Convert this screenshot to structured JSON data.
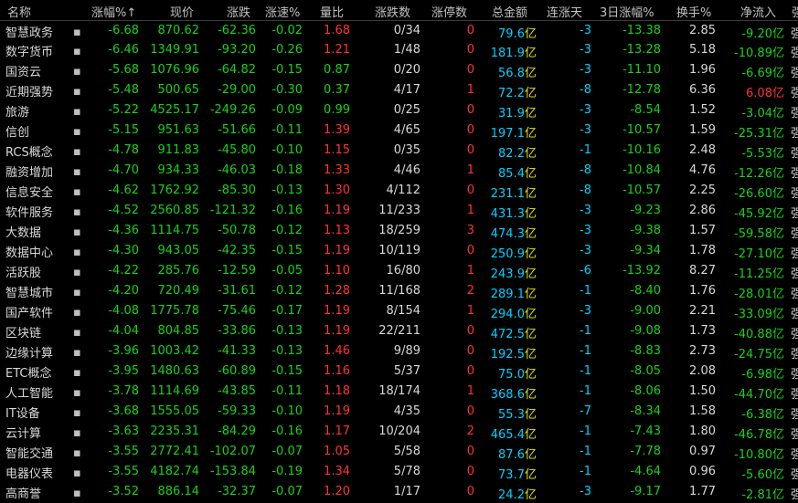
{
  "headers": [
    "名称",
    "涨幅%",
    "现价",
    "涨跌",
    "涨速%",
    "量比",
    "涨跌数",
    "涨停数",
    "总金额",
    "连涨天",
    "3日涨幅%",
    "换手%",
    "净流入",
    "强"
  ],
  "sort_arrow": "↑",
  "unit": "亿",
  "rows": [
    {
      "name": "智慧政务",
      "pct": "-6.68",
      "price": "870.62",
      "chg": "-62.36",
      "spd": "-0.02",
      "vr": "1.68",
      "ud": "0/34",
      "lim": "0",
      "amt": "79.6",
      "days": "-3",
      "d3": "-13.38",
      "turn": "2.85",
      "flow": "-9.20",
      "trail": "强"
    },
    {
      "name": "数字货币",
      "pct": "-6.46",
      "price": "1349.91",
      "chg": "-93.20",
      "spd": "-0.26",
      "vr": "1.21",
      "ud": "1/48",
      "lim": "0",
      "amt": "181.9",
      "days": "-3",
      "d3": "-13.28",
      "turn": "5.18",
      "flow": "-10.89",
      "trail": "强"
    },
    {
      "name": "国资云",
      "pct": "-5.68",
      "price": "1076.96",
      "chg": "-64.82",
      "spd": "-0.15",
      "vr": "0.87",
      "ud": "0/20",
      "lim": "0",
      "amt": "56.8",
      "days": "-3",
      "d3": "-11.10",
      "turn": "1.96",
      "flow": "-6.69",
      "trail": "强"
    },
    {
      "name": "近期强势",
      "pct": "-5.48",
      "price": "500.65",
      "chg": "-29.00",
      "spd": "-0.30",
      "vr": "0.37",
      "ud": "4/17",
      "lim": "1",
      "amt": "72.2",
      "days": "-8",
      "d3": "-12.78",
      "turn": "6.36",
      "flow": "6.08",
      "trail": "强"
    },
    {
      "name": "旅游",
      "pct": "-5.22",
      "price": "4525.17",
      "chg": "-249.26",
      "spd": "-0.09",
      "vr": "0.99",
      "ud": "0/25",
      "lim": "0",
      "amt": "31.9",
      "days": "-3",
      "d3": "-8.54",
      "turn": "1.52",
      "flow": "-3.04",
      "trail": "强"
    },
    {
      "name": "信创",
      "pct": "-5.15",
      "price": "951.63",
      "chg": "-51.66",
      "spd": "-0.11",
      "vr": "1.39",
      "ud": "4/65",
      "lim": "0",
      "amt": "197.1",
      "days": "-3",
      "d3": "-10.57",
      "turn": "1.59",
      "flow": "-25.31",
      "trail": "强"
    },
    {
      "name": "RCS概念",
      "pct": "-4.78",
      "price": "911.83",
      "chg": "-45.80",
      "spd": "-0.10",
      "vr": "1.15",
      "ud": "0/35",
      "lim": "0",
      "amt": "82.2",
      "days": "-1",
      "d3": "-10.16",
      "turn": "2.48",
      "flow": "-5.53",
      "trail": "强"
    },
    {
      "name": "融资增加",
      "pct": "-4.70",
      "price": "934.33",
      "chg": "-46.03",
      "spd": "-0.18",
      "vr": "1.33",
      "ud": "4/46",
      "lim": "1",
      "amt": "85.4",
      "days": "-8",
      "d3": "-10.84",
      "turn": "4.76",
      "flow": "-12.26",
      "trail": "强"
    },
    {
      "name": "信息安全",
      "pct": "-4.62",
      "price": "1762.92",
      "chg": "-85.30",
      "spd": "-0.13",
      "vr": "1.30",
      "ud": "4/112",
      "lim": "0",
      "amt": "231.1",
      "days": "-8",
      "d3": "-10.57",
      "turn": "2.25",
      "flow": "-26.60",
      "trail": "强"
    },
    {
      "name": "软件服务",
      "pct": "-4.52",
      "price": "2560.85",
      "chg": "-121.32",
      "spd": "-0.16",
      "vr": "1.19",
      "ud": "11/233",
      "lim": "1",
      "amt": "431.3",
      "days": "-3",
      "d3": "-9.23",
      "turn": "2.86",
      "flow": "-45.92",
      "trail": "强"
    },
    {
      "name": "大数据",
      "pct": "-4.36",
      "price": "1114.75",
      "chg": "-50.78",
      "spd": "-0.12",
      "vr": "1.13",
      "ud": "18/259",
      "lim": "3",
      "amt": "474.3",
      "days": "-3",
      "d3": "-9.38",
      "turn": "1.57",
      "flow": "-59.58",
      "trail": "强"
    },
    {
      "name": "数据中心",
      "pct": "-4.30",
      "price": "943.05",
      "chg": "-42.35",
      "spd": "-0.15",
      "vr": "1.19",
      "ud": "10/119",
      "lim": "0",
      "amt": "250.9",
      "days": "-3",
      "d3": "-9.34",
      "turn": "1.78",
      "flow": "-27.10",
      "trail": "强"
    },
    {
      "name": "活跃股",
      "pct": "-4.22",
      "price": "285.76",
      "chg": "-12.59",
      "spd": "-0.05",
      "vr": "1.10",
      "ud": "16/80",
      "lim": "1",
      "amt": "243.9",
      "days": "-6",
      "d3": "-13.92",
      "turn": "8.27",
      "flow": "-11.25",
      "trail": "强"
    },
    {
      "name": "智慧城市",
      "pct": "-4.20",
      "price": "720.49",
      "chg": "-31.61",
      "spd": "-0.12",
      "vr": "1.28",
      "ud": "11/168",
      "lim": "2",
      "amt": "289.1",
      "days": "-1",
      "d3": "-8.40",
      "turn": "1.76",
      "flow": "-28.01",
      "trail": "强"
    },
    {
      "name": "国产软件",
      "pct": "-4.08",
      "price": "1775.78",
      "chg": "-75.46",
      "spd": "-0.17",
      "vr": "1.19",
      "ud": "8/154",
      "lim": "1",
      "amt": "294.0",
      "days": "-3",
      "d3": "-9.00",
      "turn": "2.21",
      "flow": "-33.09",
      "trail": "强"
    },
    {
      "name": "区块链",
      "pct": "-4.04",
      "price": "804.85",
      "chg": "-33.86",
      "spd": "-0.13",
      "vr": "1.19",
      "ud": "22/211",
      "lim": "0",
      "amt": "472.5",
      "days": "-1",
      "d3": "-9.08",
      "turn": "1.73",
      "flow": "-40.88",
      "trail": "强"
    },
    {
      "name": "边缘计算",
      "pct": "-3.96",
      "price": "1003.42",
      "chg": "-41.33",
      "spd": "-0.13",
      "vr": "1.46",
      "ud": "9/89",
      "lim": "0",
      "amt": "192.5",
      "days": "-1",
      "d3": "-8.83",
      "turn": "2.73",
      "flow": "-24.75",
      "trail": "强"
    },
    {
      "name": "ETC概念",
      "pct": "-3.95",
      "price": "1480.63",
      "chg": "-60.89",
      "spd": "-0.15",
      "vr": "1.16",
      "ud": "5/37",
      "lim": "0",
      "amt": "75.0",
      "days": "-1",
      "d3": "-8.05",
      "turn": "2.08",
      "flow": "-6.98",
      "trail": "强"
    },
    {
      "name": "人工智能",
      "pct": "-3.78",
      "price": "1114.69",
      "chg": "-43.85",
      "spd": "-0.11",
      "vr": "1.18",
      "ud": "18/174",
      "lim": "1",
      "amt": "368.6",
      "days": "-1",
      "d3": "-8.06",
      "turn": "1.50",
      "flow": "-44.70",
      "trail": "强"
    },
    {
      "name": "IT设备",
      "pct": "-3.68",
      "price": "1555.05",
      "chg": "-59.33",
      "spd": "-0.10",
      "vr": "1.19",
      "ud": "4/35",
      "lim": "0",
      "amt": "55.3",
      "days": "-7",
      "d3": "-8.34",
      "turn": "1.58",
      "flow": "-6.38",
      "trail": "强"
    },
    {
      "name": "云计算",
      "pct": "-3.63",
      "price": "2235.31",
      "chg": "-84.29",
      "spd": "-0.16",
      "vr": "1.17",
      "ud": "10/204",
      "lim": "2",
      "amt": "465.4",
      "days": "-1",
      "d3": "-7.43",
      "turn": "1.80",
      "flow": "-46.78",
      "trail": "强"
    },
    {
      "name": "智能交通",
      "pct": "-3.55",
      "price": "2772.41",
      "chg": "-102.07",
      "spd": "-0.07",
      "vr": "1.05",
      "ud": "5/58",
      "lim": "0",
      "amt": "87.6",
      "days": "-1",
      "d3": "-7.78",
      "turn": "0.97",
      "flow": "-10.80",
      "trail": "强"
    },
    {
      "name": "电器仪表",
      "pct": "-3.55",
      "price": "4182.74",
      "chg": "-153.84",
      "spd": "-0.19",
      "vr": "1.34",
      "ud": "5/78",
      "lim": "0",
      "amt": "73.7",
      "days": "-1",
      "d3": "-4.64",
      "turn": "0.96",
      "flow": "-5.60",
      "trail": "强"
    },
    {
      "name": "高商誉",
      "pct": "-3.52",
      "price": "886.14",
      "chg": "-32.37",
      "spd": "-0.07",
      "vr": "1.20",
      "ud": "1/17",
      "lim": "0",
      "amt": "24.2",
      "days": "-3",
      "d3": "-9.17",
      "turn": "1.77",
      "flow": "-2.81",
      "trail": "强"
    }
  ]
}
